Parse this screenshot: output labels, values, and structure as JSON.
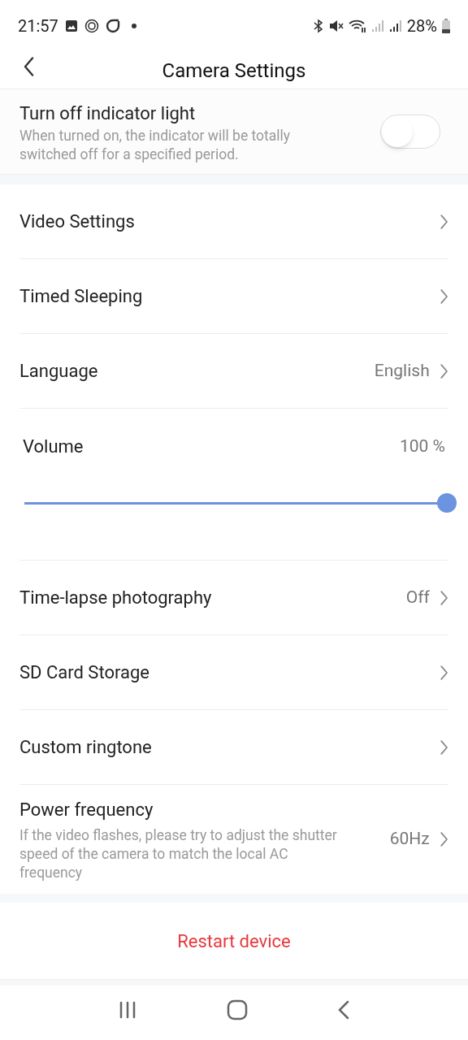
{
  "status_bar": {
    "time": "21:57",
    "battery": "28%"
  },
  "header": {
    "title": "Camera Settings"
  },
  "indicator": {
    "title": "Turn off indicator light",
    "description": "When turned on, the indicator will be totally switched off for a specified period.",
    "on": false
  },
  "items": [
    {
      "kind": "link",
      "label": "Video Settings"
    },
    {
      "kind": "link",
      "label": "Timed Sleeping"
    },
    {
      "kind": "link",
      "label": "Language",
      "value": "English"
    },
    {
      "kind": "slider",
      "label": "Volume",
      "reading": "100 %",
      "level": 1
    },
    {
      "kind": "link",
      "label": "Time-lapse photography",
      "value": "Off"
    },
    {
      "kind": "link",
      "label": "SD Card Storage"
    },
    {
      "kind": "link",
      "label": "Custom ringtone"
    },
    {
      "kind": "link",
      "label": "Power frequency",
      "description": "If the video flashes, please try to adjust the shutter speed of the camera to match the local AC frequency",
      "value": "60Hz"
    }
  ],
  "restart": {
    "label": "Restart device"
  }
}
